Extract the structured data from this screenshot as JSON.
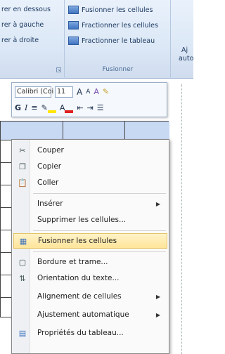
{
  "ribbon": {
    "merge_group": {
      "items": [
        {
          "label": "rer en dessous"
        },
        {
          "label": "rer à gauche"
        },
        {
          "label": "rer à droite"
        }
      ]
    },
    "fusion_group": {
      "items": [
        {
          "label": "Fusionner les cellules",
          "icon": "merge-cells-icon"
        },
        {
          "label": "Fractionner les cellules",
          "icon": "split-cells-icon"
        },
        {
          "label": "Fractionner le tableau",
          "icon": "split-table-icon"
        }
      ],
      "group_label": "Fusionner"
    },
    "autofit_group": {
      "line1": "Aj",
      "line2": "auto"
    }
  },
  "mini_toolbar": {
    "font": "Calibri (Coi",
    "size": "11",
    "grow_font": "A",
    "shrink_font": "A",
    "styles": "A",
    "bold": "G",
    "italic": "I"
  },
  "context_menu": {
    "items": [
      {
        "label": "Couper",
        "icon": "scissors-icon"
      },
      {
        "label": "Copier",
        "icon": "copy-icon"
      },
      {
        "label": "Coller",
        "icon": "paste-icon"
      },
      {
        "label": "Insérer",
        "submenu": true
      },
      {
        "label": "Supprimer les cellules..."
      },
      {
        "label": "Fusionner les cellules",
        "icon": "merge-cells-icon",
        "highlighted": true
      },
      {
        "label": "Bordure et trame...",
        "icon": "borders-icon"
      },
      {
        "label": "Orientation du texte...",
        "icon": "text-direction-icon"
      },
      {
        "label": "Alignement de cellules",
        "submenu": true
      },
      {
        "label": "Ajustement automatique",
        "submenu": true
      },
      {
        "label": "Propriétés du tableau...",
        "icon": "table-properties-icon"
      }
    ]
  },
  "colors": {
    "ribbon_bg": "#dce8f6",
    "highlight_bg": "#ffe59a",
    "selection": "#c8d9f3"
  }
}
